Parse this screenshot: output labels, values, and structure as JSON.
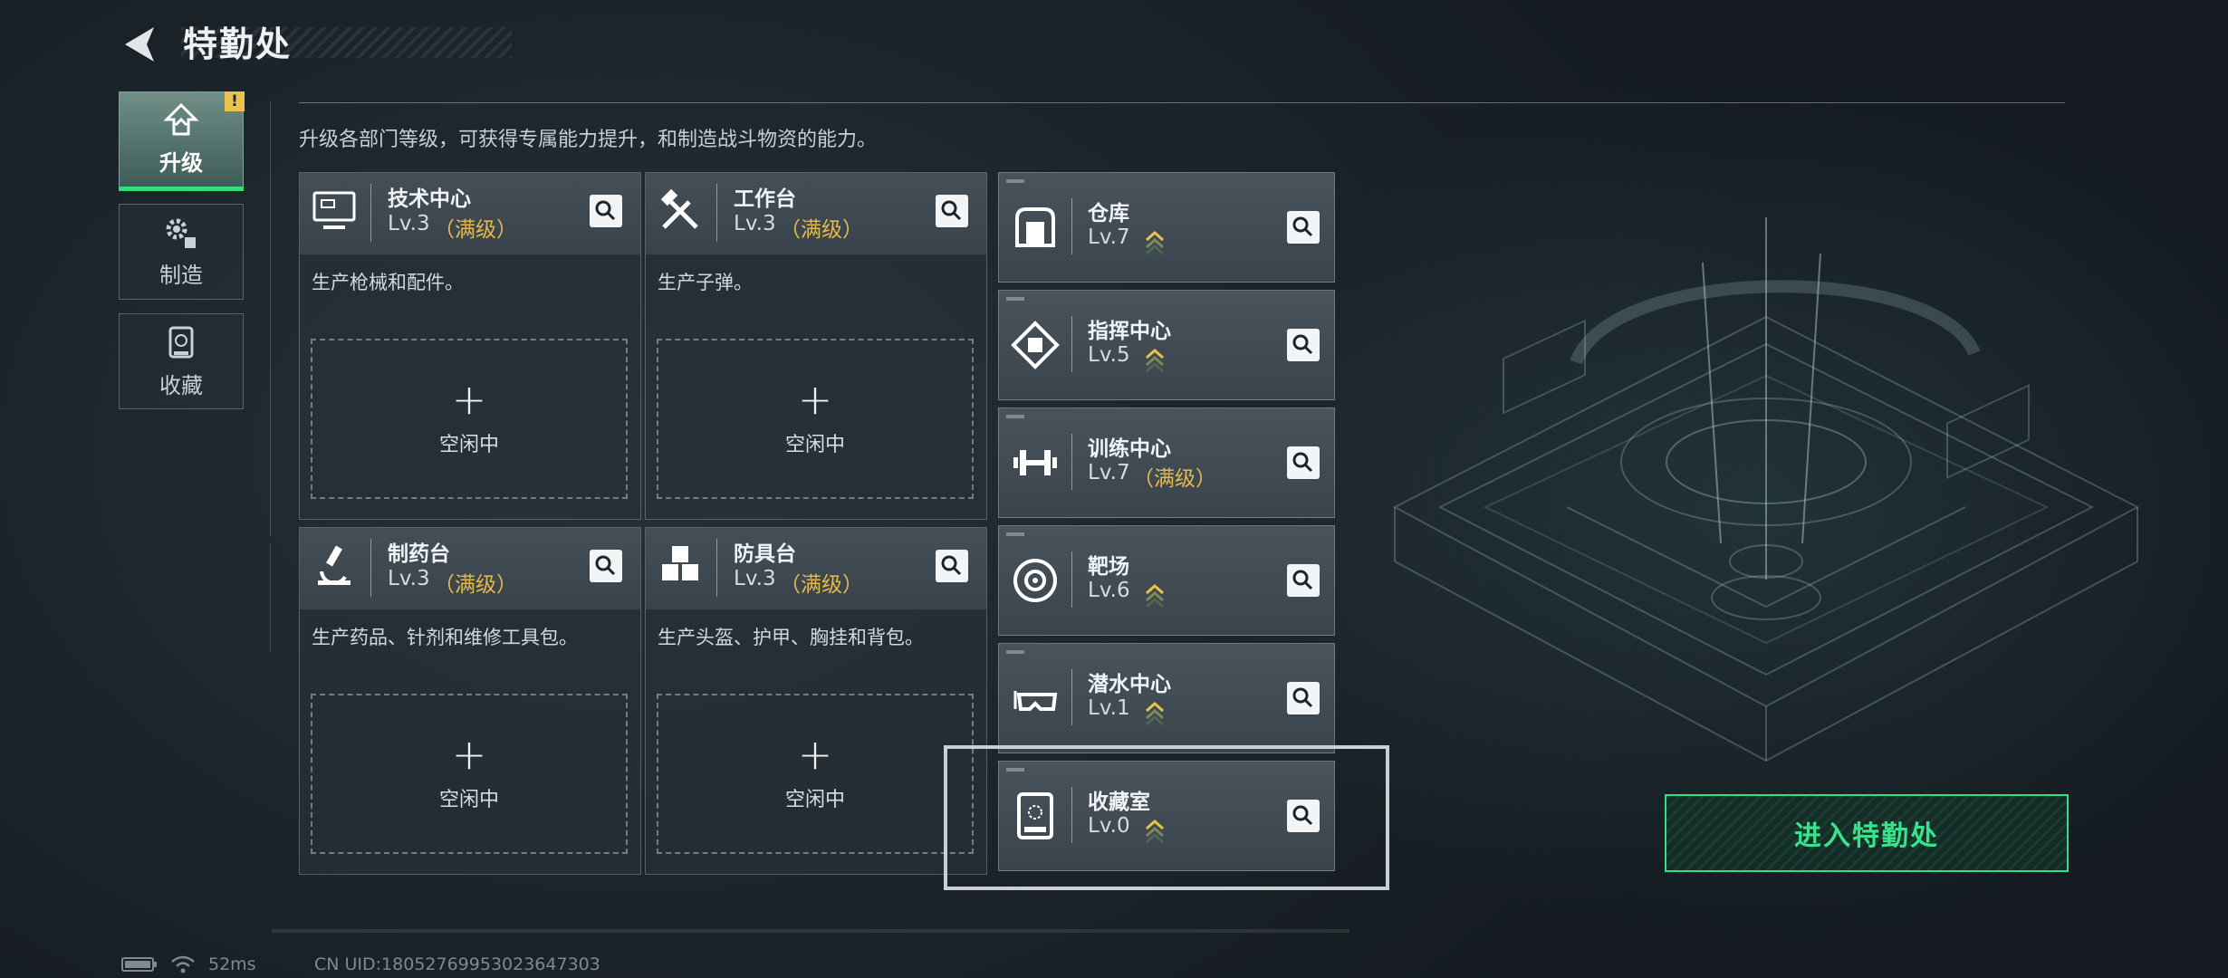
{
  "header": {
    "title": "特勤处"
  },
  "nav": {
    "items": [
      {
        "label": "升级",
        "icon": "upgrade-icon",
        "active": true
      },
      {
        "label": "制造",
        "icon": "gear-icon",
        "active": false
      },
      {
        "label": "收藏",
        "icon": "collection-icon",
        "active": false
      }
    ],
    "warning_badge": "!"
  },
  "description": "升级各部门等级，可获得专属能力提升，和制造战斗物资的能力。",
  "cards": [
    {
      "name": "技术中心",
      "level": "Lv.3",
      "max": "（满级）",
      "desc": "生产枪械和配件。",
      "idle": "空闲中",
      "plus": "+"
    },
    {
      "name": "工作台",
      "level": "Lv.3",
      "max": "（满级）",
      "desc": "生产子弹。",
      "idle": "空闲中",
      "plus": "+"
    },
    {
      "name": "制药台",
      "level": "Lv.3",
      "max": "（满级）",
      "desc": "生产药品、针剂和维修工具包。",
      "idle": "空闲中",
      "plus": "+"
    },
    {
      "name": "防具台",
      "level": "Lv.3",
      "max": "（满级）",
      "desc": "生产头盔、护甲、胸挂和背包。",
      "idle": "空闲中",
      "plus": "+"
    }
  ],
  "list": [
    {
      "name": "仓库",
      "level": "Lv.7",
      "max": "",
      "upgradable": true
    },
    {
      "name": "指挥中心",
      "level": "Lv.5",
      "max": "",
      "upgradable": true
    },
    {
      "name": "训练中心",
      "level": "Lv.7",
      "max": "（满级）",
      "upgradable": false
    },
    {
      "name": "靶场",
      "level": "Lv.6",
      "max": "",
      "upgradable": true
    },
    {
      "name": "潜水中心",
      "level": "Lv.1",
      "max": "",
      "upgradable": true
    },
    {
      "name": "收藏室",
      "level": "Lv.0",
      "max": "",
      "upgradable": true
    }
  ],
  "enter_button": "进入特勤处",
  "footer": {
    "ping": "52ms",
    "uid": "CN UID:18052769953023647303"
  },
  "colors": {
    "accent": "#2fe184",
    "max_level": "#e4b84e",
    "upgrade_arrow": "#e9c34a"
  }
}
